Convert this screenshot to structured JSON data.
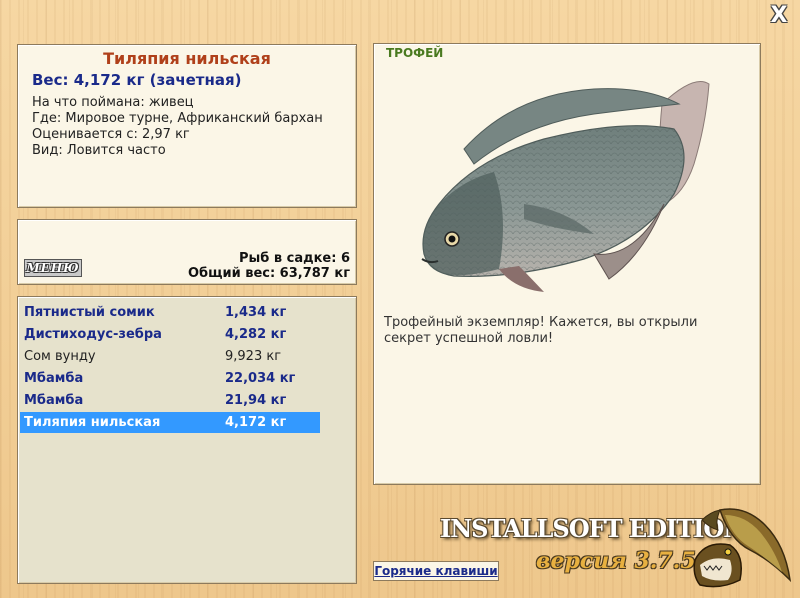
{
  "window": {
    "close_glyph": "X"
  },
  "fish": {
    "title": "Тиляпия нильская",
    "weight_line": "Вес: 4,172 кг (зачетная)",
    "bait": "На что поймана: живец",
    "location": "Где: Мировое турне, Африканский бархан",
    "value": "Оценивается с: 2,97 кг",
    "frequency": "Вид: Ловится часто"
  },
  "cage": {
    "menu_label": "МЕНЮ",
    "count_line": "Рыб в садке: 6",
    "total_line": "Общий вес: 63,787 кг"
  },
  "catch_list": [
    {
      "name": "Пятнистый сомик",
      "weight": "1,434 кг",
      "style": "bold"
    },
    {
      "name": "Дистиходус-зебра",
      "weight": "4,282 кг",
      "style": "bold"
    },
    {
      "name": "Сом вунду",
      "weight": "9,923 кг",
      "style": "normal"
    },
    {
      "name": "Мбамба",
      "weight": "22,034 кг",
      "style": "bold"
    },
    {
      "name": "Мбамба",
      "weight": "21,94 кг",
      "style": "bold"
    },
    {
      "name": "Тиляпия нильская",
      "weight": "4,172 кг",
      "style": "selected"
    }
  ],
  "trophy": {
    "label": "ТРОФЕЙ",
    "message": "Трофейный экземпляр! Кажется, вы открыли секрет успешной ловли!"
  },
  "branding": {
    "edition": "INSTALLSOFT EDITION",
    "version": "версия 3.7.5"
  },
  "footer": {
    "hotkeys_label": "Горячие клавиши"
  },
  "colors": {
    "title_red": "#b0401a",
    "accent_blue": "#1a2a8a",
    "selection_blue": "#3399ff",
    "trophy_green": "#4a7a20"
  }
}
